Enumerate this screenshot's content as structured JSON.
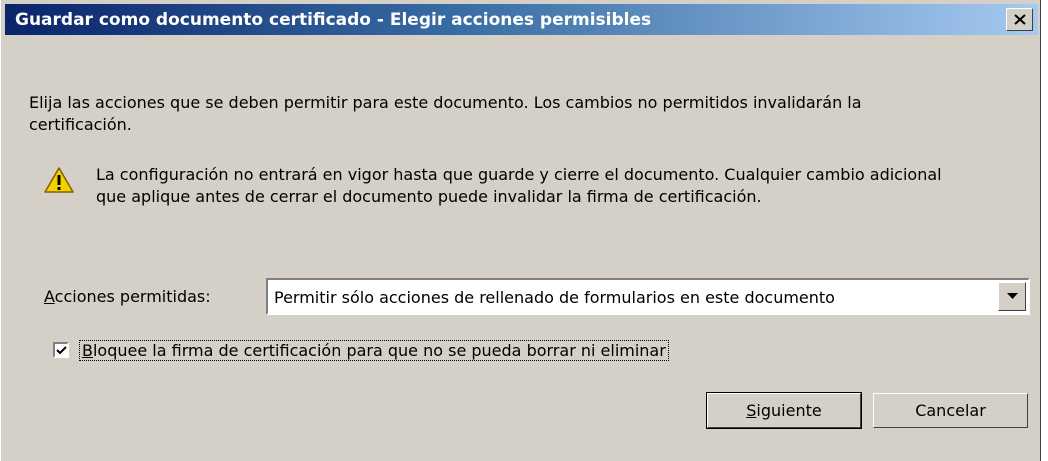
{
  "window": {
    "title": "Guardar como documento certificado - Elegir acciones permisibles"
  },
  "intro_text": "Elija las acciones que se deben permitir para este documento. Los cambios no permitidos invalidarán la certificación.",
  "warning": {
    "icon": "warning-icon",
    "text": "La configuración no entrará en vigor hasta que guarde y cierre el documento. Cualquier cambio adicional que aplique antes de cerrar el documento puede invalidar la firma de certificación."
  },
  "actions": {
    "label_mnemonic": "A",
    "label_rest": "cciones permitidas:",
    "selected": "Permitir sólo acciones de rellenado de formularios en este documento"
  },
  "lock_checkbox": {
    "checked": true,
    "label_mnemonic": "B",
    "label_rest": "loquee la firma de certificación para que no se pueda borrar ni eliminar"
  },
  "buttons": {
    "next_mnemonic": "S",
    "next_rest": "iguiente",
    "cancel": "Cancelar"
  }
}
